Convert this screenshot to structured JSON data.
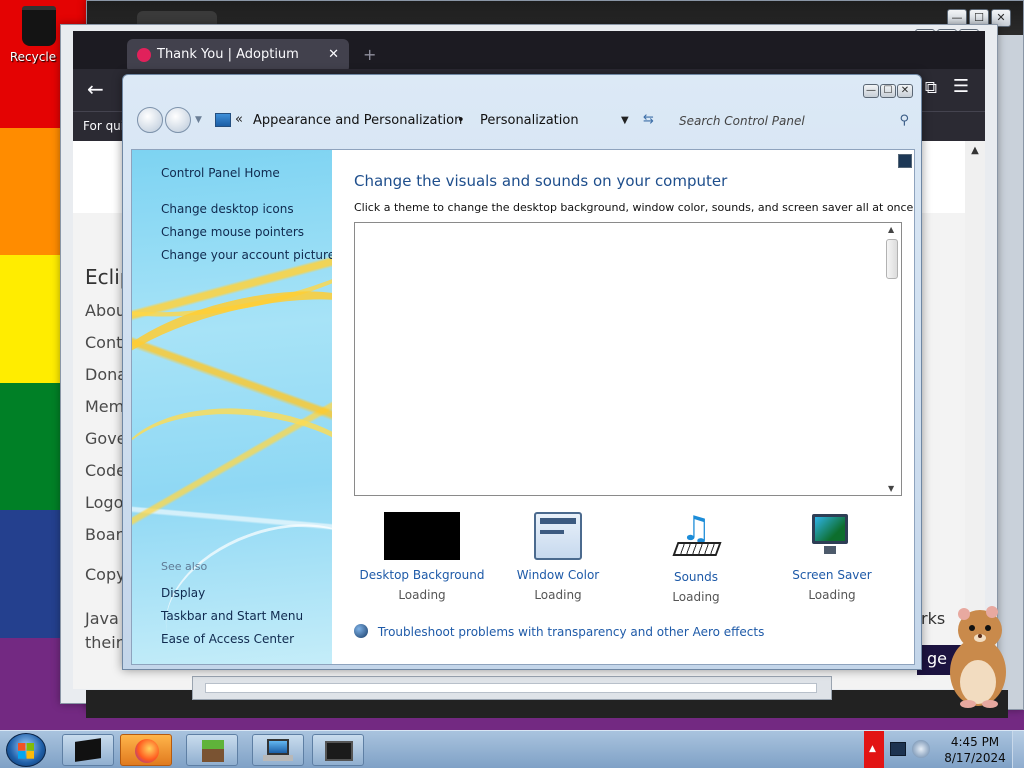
{
  "desktop": {
    "stripe_colors": [
      "#e40303",
      "#ff8c00",
      "#ffed00",
      "#008026",
      "#24408e",
      "#732982"
    ],
    "icons": {
      "recycle_bin_label": "Recycle B"
    }
  },
  "back_windows": {
    "window_buttons": {
      "minimize": "—",
      "maximize": "☐",
      "close": "✕"
    }
  },
  "firefox": {
    "tab": {
      "title": "Thank You | Adoptium",
      "close": "✕"
    },
    "new_tab": "+",
    "nav": {
      "back": "←",
      "extensions": "⧉",
      "menu": "☰"
    },
    "subbar_text": "For quic",
    "page": {
      "heading": "Eclip",
      "links": [
        "Abou",
        "Conta",
        "Dona",
        "Mem",
        "Gove",
        "Code",
        "Logo",
        "Boar",
        "Copy",
        "Java a",
        "their"
      ],
      "right_clip": "rks",
      "page_button": "ge"
    }
  },
  "control_panel": {
    "window_buttons": {
      "minimize": "—",
      "maximize": "☐",
      "close": "✕"
    },
    "address": {
      "chevron": "«",
      "crumbs": [
        "Appearance and Personalization",
        "Personalization"
      ],
      "separator": "•",
      "dropdown": "▼",
      "refresh": "⇆",
      "search_placeholder": "Search Control Panel",
      "search_icon": "⚲"
    },
    "left_pane": {
      "links": [
        "Control Panel Home",
        "Change desktop icons",
        "Change mouse pointers",
        "Change your account picture"
      ],
      "see_also_label": "See also",
      "see_also_links": [
        "Display",
        "Taskbar and Start Menu",
        "Ease of Access Center"
      ]
    },
    "main": {
      "title": "Change the visuals and sounds on your computer",
      "description": "Click a theme to change the desktop background, window color, sounds, and screen saver all at once.",
      "options": [
        {
          "label": "Desktop Background",
          "status": "Loading",
          "icon": "desktop-background-icon"
        },
        {
          "label": "Window Color",
          "status": "Loading",
          "icon": "window-color-icon"
        },
        {
          "label": "Sounds",
          "status": "Loading",
          "icon": "sounds-icon"
        },
        {
          "label": "Screen Saver",
          "status": "Loading",
          "icon": "screen-saver-icon"
        }
      ],
      "troubleshoot": "Troubleshoot problems with transparency and other Aero effects"
    }
  },
  "taskbar": {
    "items": [
      "start-orb",
      "glass-app",
      "firefox",
      "minecraft",
      "control-panel",
      "terminal"
    ],
    "tray_arrow": "▲",
    "clock": {
      "time": "4:45 PM",
      "date": "8/17/2024"
    }
  }
}
